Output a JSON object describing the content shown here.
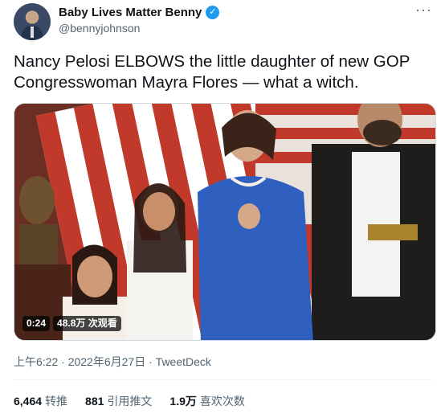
{
  "author": {
    "display_name": "Baby Lives Matter Benny",
    "handle": "@bennyjohnson",
    "verified_icon": "verified-badge-icon",
    "more_icon": "more-options-icon"
  },
  "tweet": {
    "text": "Nancy Pelosi ELBOWS the little daughter of new GOP Congresswoman Mayra Flores — what a witch."
  },
  "video": {
    "duration": "0:24",
    "views": "48.8万 次观看"
  },
  "meta": {
    "time": "上午6:22",
    "separator1": " · ",
    "date": "2022年6月27日",
    "separator2": " · ",
    "source": "TweetDeck"
  },
  "stats": {
    "retweets_count": "6,464",
    "retweets_label": "转推",
    "quotes_count": "881",
    "quotes_label": "引用推文",
    "likes_count": "1.9万",
    "likes_label": "喜欢次数"
  },
  "colors": {
    "accent": "#1d9bf0",
    "text": "#0f1419",
    "secondary": "#536471"
  }
}
